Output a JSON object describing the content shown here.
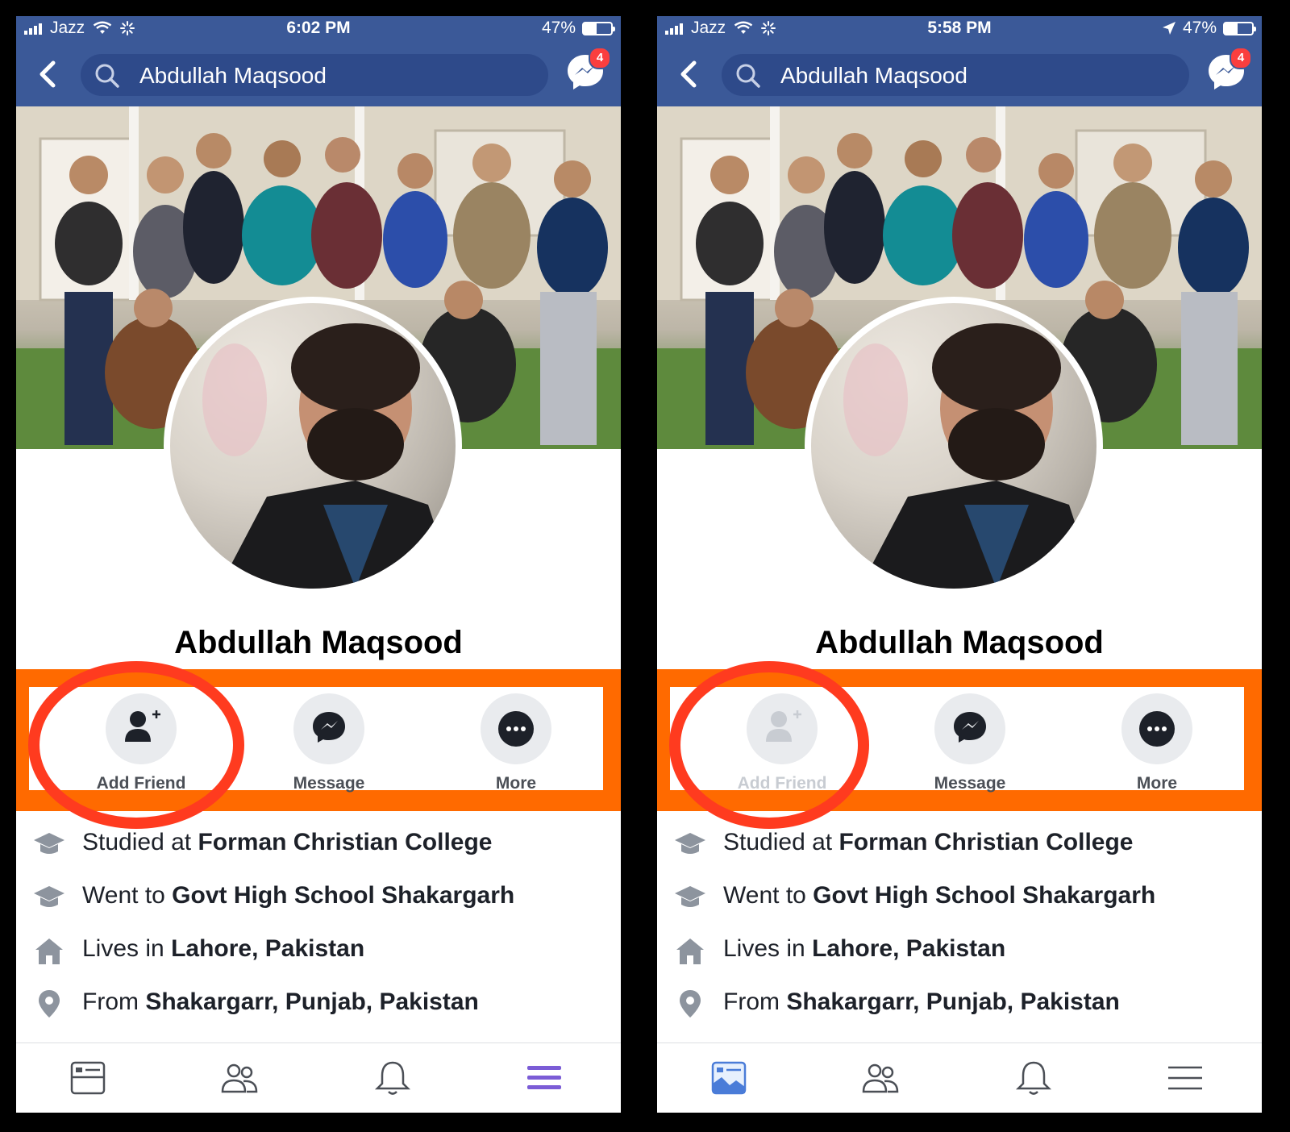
{
  "panels": {
    "left": {
      "status": {
        "carrier": "Jazz",
        "time": "6:02 PM",
        "battery": "47%",
        "location_arrow": false
      },
      "search": {
        "query": "Abdullah Maqsood"
      },
      "messenger_badge": "4",
      "profile_name": "Abdullah Maqsood",
      "actions": {
        "add_friend": "Add Friend",
        "message": "Message",
        "more": "More",
        "add_friend_state": "enabled"
      },
      "about": {
        "studied_prefix": "Studied at ",
        "studied_value": "Forman Christian College",
        "went_prefix": "Went to ",
        "went_value": "Govt High School Shakargarh",
        "lives_prefix": "Lives in ",
        "lives_value": "Lahore, Pakistan",
        "from_prefix": "From ",
        "from_value": "Shakargarr, Punjab, Pakistan"
      },
      "tabs": [
        "news-feed-icon",
        "friends-icon",
        "notifications-icon",
        "menu-icon"
      ],
      "active_tab": "menu-icon"
    },
    "right": {
      "status": {
        "carrier": "Jazz",
        "time": "5:58 PM",
        "battery": "47%",
        "location_arrow": true
      },
      "search": {
        "query": "Abdullah Maqsood"
      },
      "messenger_badge": "4",
      "profile_name": "Abdullah Maqsood",
      "actions": {
        "add_friend": "Add Friend",
        "message": "Message",
        "more": "More",
        "add_friend_state": "disabled"
      },
      "about": {
        "studied_prefix": "Studied at ",
        "studied_value": "Forman Christian College",
        "went_prefix": "Went to ",
        "went_value": "Govt High School Shakargarh",
        "lives_prefix": "Lives in ",
        "lives_value": "Lahore, Pakistan",
        "from_prefix": "From ",
        "from_value": "Shakargarr, Punjab, Pakistan"
      },
      "tabs": [
        "news-feed-icon",
        "friends-icon",
        "notifications-icon",
        "menu-icon"
      ],
      "active_tab": "news-feed-icon"
    }
  },
  "colors": {
    "facebook_blue": "#3b5998",
    "annotation_orange": "#ff6a00",
    "annotation_red": "#ff3b1f",
    "active_tab": "#7b5cd6",
    "notification_badge": "#fa3e3e"
  }
}
